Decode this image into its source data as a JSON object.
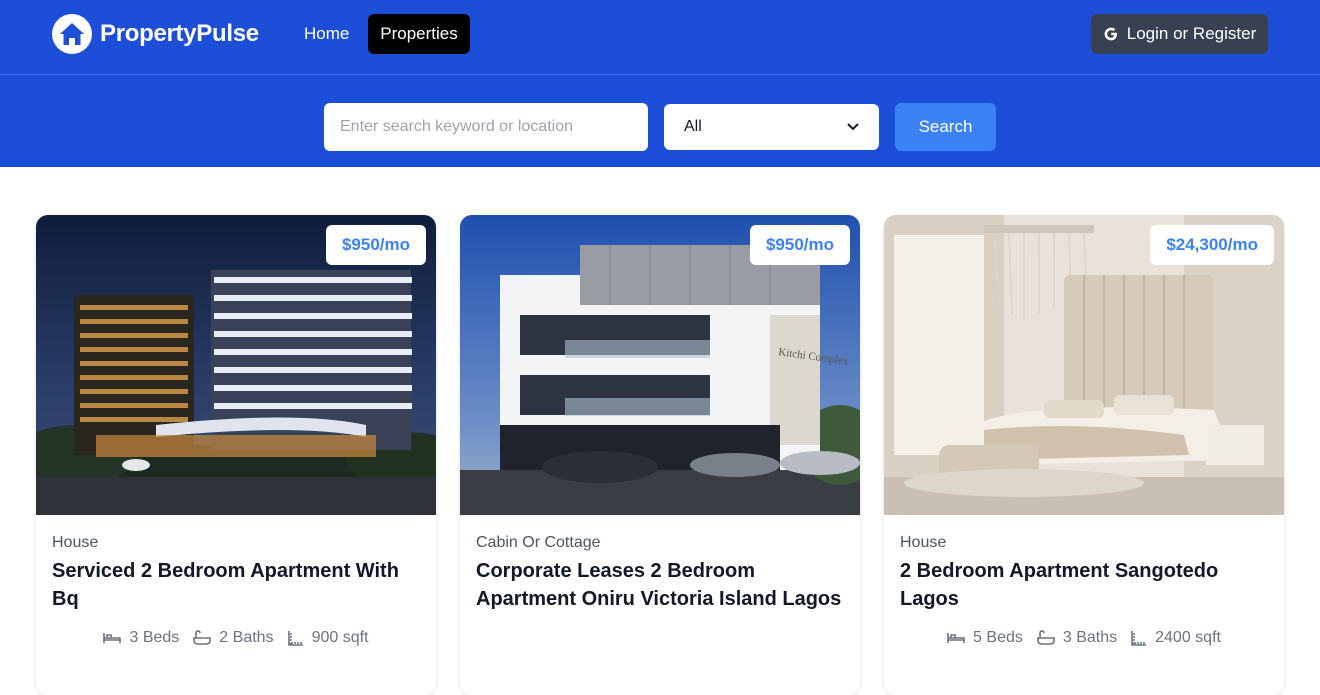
{
  "header": {
    "brand": "PropertyPulse",
    "nav": {
      "home": "Home",
      "properties": "Properties"
    },
    "login_label": "Login or Register",
    "colors": {
      "bar": "#1d4ed8",
      "active_nav": "#000000",
      "login_bg": "#374151"
    },
    "icons": {
      "logo": "house-icon",
      "login": "google-g-icon"
    }
  },
  "search": {
    "placeholder": "Enter search keyword or location",
    "type_selected": "All",
    "button_label": "Search",
    "button_color": "#3b82f6"
  },
  "properties": [
    {
      "price": "$950/mo",
      "type": "House",
      "name": "Serviced 2 Bedroom Apartment With Bq",
      "beds": "3 Beds",
      "baths": "2 Baths",
      "sqft": "900 sqft"
    },
    {
      "price": "$950/mo",
      "type": "Cabin Or Cottage",
      "name": "Corporate Leases 2 Bedroom Apartment Oniru Victoria Island Lagos",
      "sign": "Kitchi Complex"
    },
    {
      "price": "$24,300/mo",
      "type": "House",
      "name": "2 Bedroom Apartment Sangotedo Lagos",
      "beds": "5 Beds",
      "baths": "3 Baths",
      "sqft": "2400 sqft"
    }
  ]
}
